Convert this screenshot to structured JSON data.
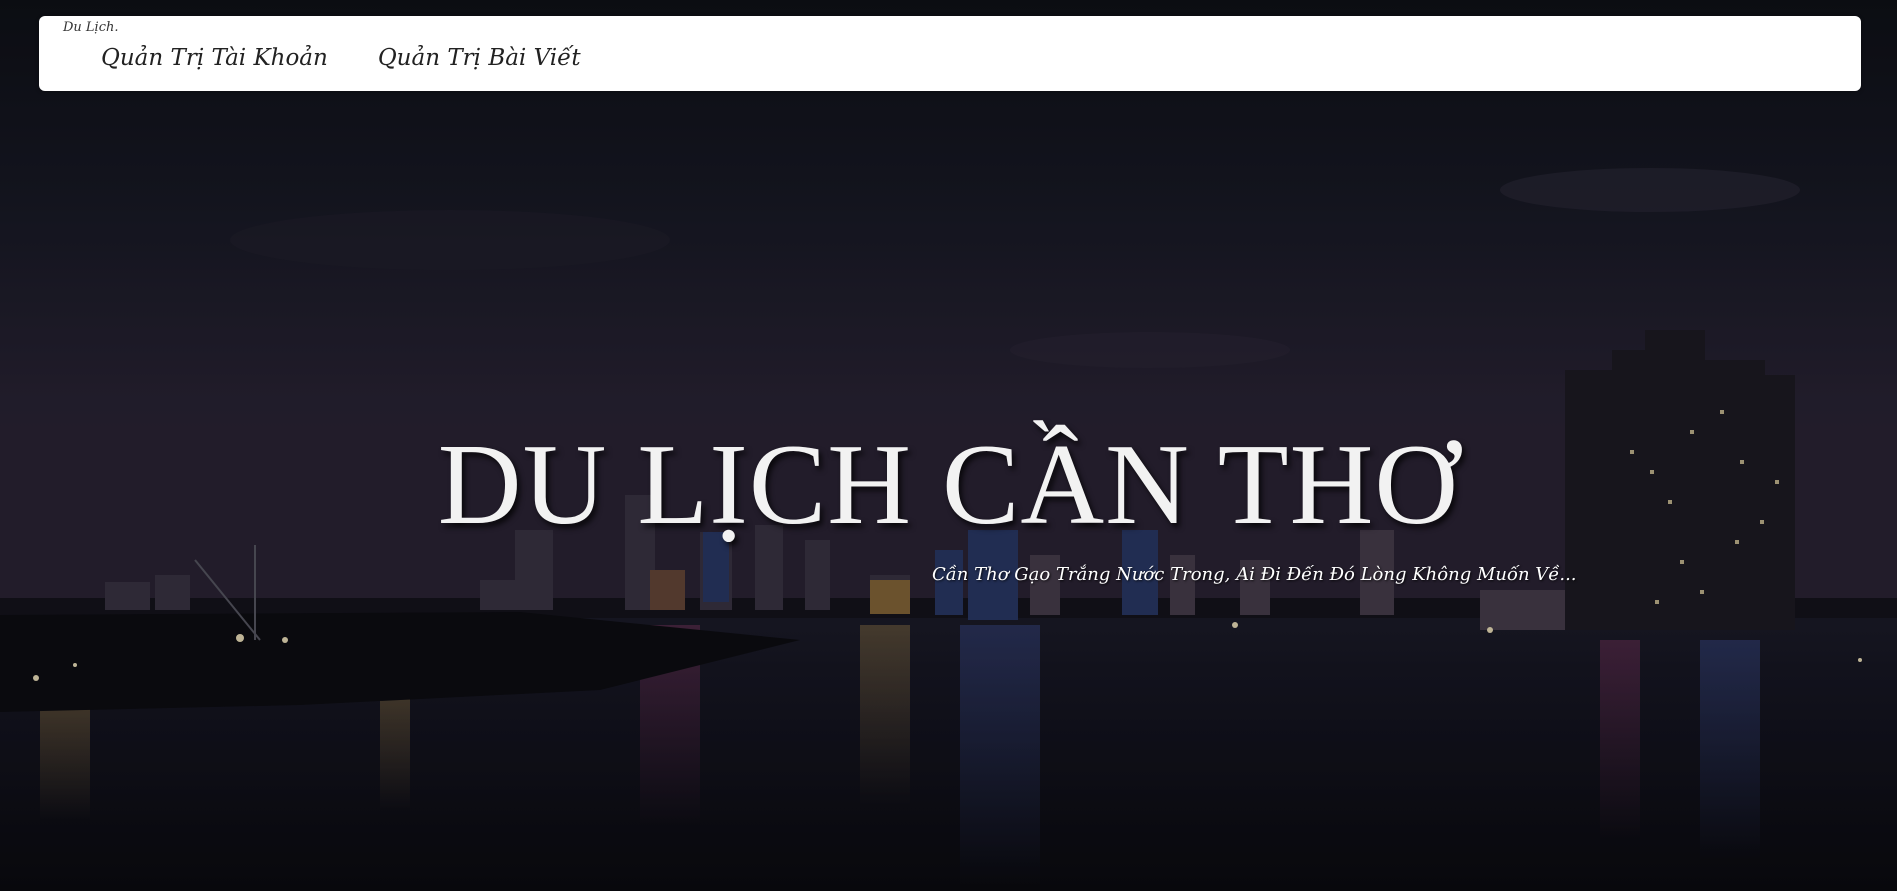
{
  "navbar": {
    "brand": "Du Lịch.",
    "links": [
      {
        "label": "Quản Trị Tài Khoản"
      },
      {
        "label": "Quản Trị Bài Viết"
      }
    ]
  },
  "hero": {
    "title": "DU LỊCH CẦN THƠ",
    "subtitle": "Cần Thơ Gạo Trắng Nước Trong, Ai Đi Đến Đó Lòng Không Muốn Về..."
  },
  "colors": {
    "navbar_bg": "#ffffff",
    "nav_text": "#222222",
    "hero_text": "#f2f2f2",
    "sky": "#1b1a2a",
    "river": "#0f1016"
  }
}
